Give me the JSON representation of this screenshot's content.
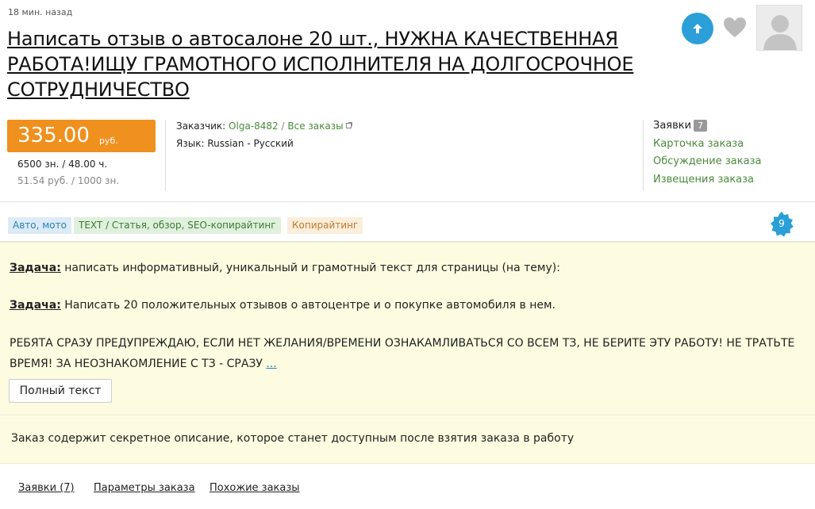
{
  "order": {
    "posted": "18 мин. назад",
    "title": "Написать отзыв о автосалоне 20 шт., НУЖНА КАЧЕСТВЕННАЯ РАБОТА!ИЩУ ГРАМОТНОГО ИСПОЛНИТЕЛЯ НА ДОЛГОСРОЧНОЕ СОТРУДНИЧЕСТВО"
  },
  "price": {
    "value": "335.00",
    "currency": "руб.",
    "chars": "6500 зн.",
    "separator": "/",
    "hours": "48.00 ч.",
    "rate": "51.54 руб.",
    "per": "1000 зн."
  },
  "customer": {
    "label": "Заказчик:",
    "name": "Olga-8482",
    "separator": "/",
    "all_orders": "Все заказы",
    "lang_label": "Язык:",
    "lang_value": "Russian - Русский"
  },
  "side_links": {
    "bids_label": "Заявки",
    "bids_count": "7",
    "card": "Карточка заказа",
    "discussion": "Обсуждение заказа",
    "notifications": "Извещения заказа"
  },
  "tags": [
    "Авто, мото",
    "TEXT / Статья, обзор, SEO-копирайтинг",
    "Копирайтинг"
  ],
  "badge_count": "9",
  "task": {
    "label": "Задача:",
    "line1": " написать информативный, уникальный и грамотный текст для страницы (на тему):",
    "line2": " Написать 20 положительных отзывов о автоцентре и о покупке автомобиля в нем.",
    "body": "РЕБЯТА СРАЗУ ПРЕДУПРЕЖДАЮ, ЕСЛИ НЕТ ЖЕЛАНИЯ/ВРЕМЕНИ ОЗНАКАМЛИВАТЬСЯ СО ВСЕМ ТЗ, НЕ БЕРИТЕ ЭТУ РАБОТУ! НЕ ТРАТЬТЕ ВРЕМЯ! ЗА НЕОЗНАКОМЛЕНИЕ С ТЗ - СРАЗУ",
    "more": "...",
    "full_text_button": "Полный текст"
  },
  "secret_notice": "Заказ содержит секретное описание, которое станет доступным после взятия заказа в работу",
  "bottom_tabs": [
    "Заявки (7)",
    "Параметры заказа",
    "Похожие заказы"
  ],
  "colors": {
    "price_bg": "#f0901e",
    "accent_blue": "#2a9fd8",
    "link_green": "#4a8a3c",
    "task_bg": "#fdfce0"
  }
}
